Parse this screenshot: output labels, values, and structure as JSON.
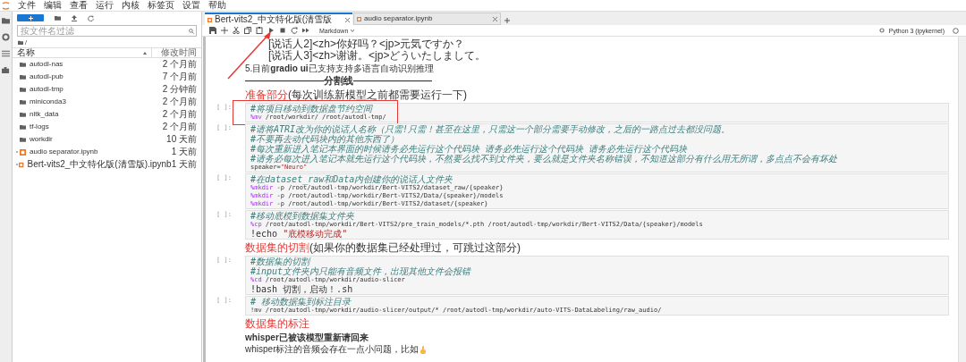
{
  "menu": [
    "文件",
    "编辑",
    "查看",
    "运行",
    "内核",
    "标签页",
    "设置",
    "帮助"
  ],
  "sidebar": {
    "filter": {
      "placeholder": "按文件名过滤"
    },
    "breadcrumb": "/",
    "columns": [
      "名称",
      "修改时间"
    ],
    "files": [
      {
        "kind": "folder",
        "name": "autodl-nas",
        "modified": "2 个月前"
      },
      {
        "kind": "folder",
        "name": "autodl-pub",
        "modified": "7 个月前"
      },
      {
        "kind": "folder",
        "name": "autodl-tmp",
        "modified": "2 分钟前"
      },
      {
        "kind": "folder",
        "name": "miniconda3",
        "modified": "2 个月前"
      },
      {
        "kind": "folder",
        "name": "nltk_data",
        "modified": "2 个月前"
      },
      {
        "kind": "folder",
        "name": "tf-logs",
        "modified": "2 个月前"
      },
      {
        "kind": "folder",
        "name": "workdir",
        "modified": "10 天前"
      },
      {
        "kind": "notebook",
        "name": "audio separator.ipynb",
        "modified": "1 天前"
      },
      {
        "kind": "notebook",
        "name": "Bert-vits2_中文特化版(清雪版).ipynb",
        "modified": "1 天前"
      }
    ]
  },
  "tabs": [
    {
      "label": "Bert-vits2_中文特化版(清雪版",
      "selected": true
    },
    {
      "label": "audio separator.ipynb",
      "selected": false
    }
  ],
  "toolbar": {
    "cell_type": "Markdown",
    "kernel": "Python 3 (ipykernel)"
  },
  "cells": [
    {
      "kind": "raw",
      "lines": [
        "[说话人2]<zh>你好吗？<jp>元気ですか？",
        "[说话人3]<zh>谢谢。<jp>どういたしまして。"
      ]
    },
    {
      "kind": "paragraph",
      "text": "5.目前**gradio ui**已支持支持多语言自动识别推理"
    },
    {
      "kind": "divider",
      "text": "————————分割线————————"
    },
    {
      "kind": "heading",
      "accent": "准备部分",
      "rest": "(每次训练新模型之前都需要运行一下)"
    },
    {
      "kind": "code",
      "prompt": "[ ]:",
      "highlighted": true,
      "lines": [
        [
          {
            "kind": "comment",
            "text": "#将项目移动到数据盘节约空间"
          }
        ],
        [
          {
            "kind": "magic",
            "text": "%mv"
          },
          {
            "kind": "plain",
            "text": " /root/workdir/ /root/autodl-tmp/"
          }
        ]
      ]
    },
    {
      "kind": "code",
      "prompt": "[ ]:",
      "lines": [
        [
          {
            "kind": "comment",
            "text": "#请将ATRI改为你的说话人名称（只需!只需！甚至在这里，只需这一个部分需要手动修改，之后的一路点过去都没问题。"
          }
        ],
        [
          {
            "kind": "comment",
            "text": "#不要再去动代码块内的其他东西了）"
          }
        ],
        [
          {
            "kind": "comment",
            "text": "#每次重新进入笔记本界面的时候请务必先运行这个代码块 请务必先运行这个代码块 请务必先运行这个代码块"
          }
        ],
        [
          {
            "kind": "comment",
            "text": "#请务必每次进入笔记本就先运行这个代码块，不然要么找不到文件夹，要么就是文件夹名称错误，不知道这部分有什么用无所谓，多点点不会有坏处"
          }
        ],
        [
          {
            "kind": "plain",
            "text": "speaker="
          },
          {
            "kind": "string",
            "text": "\"Neuro\""
          }
        ]
      ]
    },
    {
      "kind": "code",
      "prompt": "[ ]:",
      "lines": [
        [
          {
            "kind": "comment",
            "text": "#在dataset_raw和Data内创建你的说话人文件夹"
          }
        ],
        [
          {
            "kind": "magic",
            "text": "%mkdir"
          },
          {
            "kind": "plain",
            "text": " -p /root/autodl-tmp/workdir/Bert-VITS2/dataset_raw/{speaker}"
          }
        ],
        [
          {
            "kind": "magic",
            "text": "%mkdir"
          },
          {
            "kind": "plain",
            "text": " -p /root/autodl-tmp/workdir/Bert-VITS2/Data/{speaker}/models"
          }
        ],
        [
          {
            "kind": "magic",
            "text": "%mkdir"
          },
          {
            "kind": "plain",
            "text": " -p /root/autodl-tmp/workdir/Bert-VITS2/dataset/{speaker}"
          }
        ]
      ]
    },
    {
      "kind": "code",
      "prompt": "[ ]:",
      "lines": [
        [
          {
            "kind": "comment",
            "text": "#移动底模到数据集文件夹"
          }
        ],
        [
          {
            "kind": "magic",
            "text": "%cp"
          },
          {
            "kind": "plain",
            "text": " /root/autodl-tmp/workdir/Bert-VITS2/pre_train_models/*.pth /root/autodl-tmp/workdir/Bert-VITS2/Data/{speaker}/models"
          }
        ],
        [
          {
            "kind": "plain",
            "text": "!echo "
          },
          {
            "kind": "string",
            "text": "\"底模移动完成\""
          }
        ]
      ]
    },
    {
      "kind": "heading",
      "accent": "数据集的切割",
      "rest": "(如果你的数据集已经处理过，可跳过这部分)"
    },
    {
      "kind": "code",
      "prompt": "[ ]:",
      "lines": [
        [
          {
            "kind": "comment",
            "text": "#数据集的切割"
          }
        ],
        [
          {
            "kind": "comment",
            "text": "#input文件夹内只能有音频文件，出现其他文件会报错"
          }
        ],
        [
          {
            "kind": "magic",
            "text": "%cd"
          },
          {
            "kind": "plain",
            "text": " /root/autodl-tmp/workdir/audio-slicer"
          }
        ],
        [
          {
            "kind": "plain",
            "text": "!bash 切割，启动！.sh"
          }
        ]
      ]
    },
    {
      "kind": "code",
      "prompt": "[ ]:",
      "lines": [
        [
          {
            "kind": "comment",
            "text": "# 移动数据集到标注目录"
          }
        ],
        [
          {
            "kind": "plain",
            "text": "!mv /root/autodl-tmp/workdir/audio-slicer/output/* /root/autodl-tmp/workdir/auto-VITS-DataLabeling/raw_audio/"
          }
        ]
      ]
    },
    {
      "kind": "heading",
      "accent": "数据集的标注"
    },
    {
      "kind": "bold",
      "text": "whisper已被该模型重新请回来"
    },
    {
      "kind": "note",
      "text": "whisper标注的音频会存在一点小问题，比如"
    }
  ]
}
